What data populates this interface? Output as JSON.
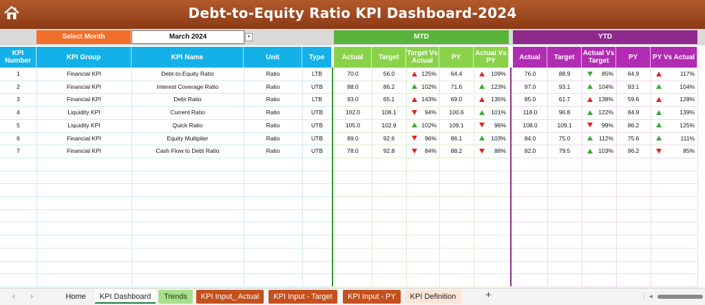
{
  "header": {
    "title": "Debt-to-Equity Ratio KPI Dashboard-2024"
  },
  "selector": {
    "label": "Select Month",
    "value": "March 2024"
  },
  "sections": {
    "mtd": "MTD",
    "ytd": "YTD"
  },
  "columns": {
    "kpi_number": "KPI Number",
    "kpi_group": "KPI Group",
    "kpi_name": "KPI Name",
    "unit": "Unit",
    "type": "Type",
    "mtd_actual": "Actual",
    "mtd_target": "Target",
    "mtd_tva": "Target Vs Actual",
    "mtd_py": "PY",
    "mtd_avp": "Actual Vs PY",
    "ytd_actual": "Actual",
    "ytd_target": "Target",
    "ytd_avt": "Actual Vs Target",
    "ytd_py": "PY",
    "ytd_pva": "PY Vs Actual"
  },
  "colors": {
    "up": "#3aa935",
    "down": "#e3231b",
    "banner": "#9a4420",
    "mtd": "#57b33a",
    "ytd": "#8e2a8c",
    "blue": "#14b1e8"
  },
  "rows": [
    {
      "num": "1",
      "group": "Financial KPI",
      "name": "Debt-to-Equity Ratio",
      "unit": "Ratio",
      "type": "LTB",
      "mtd_actual": "70.0",
      "mtd_target": "56.0",
      "mtd_tva": "125%",
      "mtd_tva_dir": "up-red",
      "mtd_py": "64.4",
      "mtd_avp": "109%",
      "mtd_avp_dir": "up-red",
      "ytd_actual": "76.0",
      "ytd_target": "88.9",
      "ytd_avt": "85%",
      "ytd_avt_dir": "down-green",
      "ytd_py": "64.9",
      "ytd_pva": "117%",
      "ytd_pva_dir": "up-red"
    },
    {
      "num": "2",
      "group": "Financial KPI",
      "name": "Interest Coverage Ratio",
      "unit": "Ratio",
      "type": "UTB",
      "mtd_actual": "88.0",
      "mtd_target": "86.2",
      "mtd_tva": "102%",
      "mtd_tva_dir": "up-green",
      "mtd_py": "71.6",
      "mtd_avp": "123%",
      "mtd_avp_dir": "up-green",
      "ytd_actual": "97.0",
      "ytd_target": "93.1",
      "ytd_avt": "104%",
      "ytd_avt_dir": "up-green",
      "ytd_py": "93.1",
      "ytd_pva": "104%",
      "ytd_pva_dir": "up-green"
    },
    {
      "num": "3",
      "group": "Financial KPI",
      "name": "Debt Ratio",
      "unit": "Ratio",
      "type": "LTB",
      "mtd_actual": "93.0",
      "mtd_target": "65.1",
      "mtd_tva": "143%",
      "mtd_tva_dir": "up-red",
      "mtd_py": "69.0",
      "mtd_avp": "135%",
      "mtd_avp_dir": "up-red",
      "ytd_actual": "85.0",
      "ytd_target": "61.7",
      "ytd_avt": "138%",
      "ytd_avt_dir": "up-red",
      "ytd_py": "59.6",
      "ytd_pva": "128%",
      "ytd_pva_dir": "up-red"
    },
    {
      "num": "4",
      "group": "Liquidity KPI",
      "name": "Current Ratio",
      "unit": "Ratio",
      "type": "UTB",
      "mtd_actual": "102.0",
      "mtd_target": "108.1",
      "mtd_tva": "94%",
      "mtd_tva_dir": "down-red",
      "mtd_py": "100.6",
      "mtd_avp": "101%",
      "mtd_avp_dir": "up-green",
      "ytd_actual": "118.0",
      "ytd_target": "96.8",
      "ytd_avt": "122%",
      "ytd_avt_dir": "up-green",
      "ytd_py": "84.9",
      "ytd_pva": "139%",
      "ytd_pva_dir": "up-green"
    },
    {
      "num": "5",
      "group": "Liquidity KPI",
      "name": "Quick Ratio",
      "unit": "Ratio",
      "type": "UTB",
      "mtd_actual": "105.0",
      "mtd_target": "102.9",
      "mtd_tva": "102%",
      "mtd_tva_dir": "up-green",
      "mtd_py": "109.1",
      "mtd_avp": "96%",
      "mtd_avp_dir": "down-red",
      "ytd_actual": "108.0",
      "ytd_target": "109.1",
      "ytd_avt": "99%",
      "ytd_avt_dir": "down-red",
      "ytd_py": "86.2",
      "ytd_pva": "125%",
      "ytd_pva_dir": "up-green"
    },
    {
      "num": "6",
      "group": "Financial KPI",
      "name": "Equity Multiplier",
      "unit": "Ratio",
      "type": "UTB",
      "mtd_actual": "89.0",
      "mtd_target": "92.6",
      "mtd_tva": "96%",
      "mtd_tva_dir": "down-red",
      "mtd_py": "86.1",
      "mtd_avp": "103%",
      "mtd_avp_dir": "up-green",
      "ytd_actual": "84.0",
      "ytd_target": "75.0",
      "ytd_avt": "112%",
      "ytd_avt_dir": "up-green",
      "ytd_py": "75.6",
      "ytd_pva": "111%",
      "ytd_pva_dir": "up-green"
    },
    {
      "num": "7",
      "group": "Financial KPI",
      "name": "Cash Flow to Debt Ratio",
      "unit": "Ratio",
      "type": "UTB",
      "mtd_actual": "78.0",
      "mtd_target": "92.8",
      "mtd_tva": "84%",
      "mtd_tva_dir": "down-red",
      "mtd_py": "88.2",
      "mtd_avp": "88%",
      "mtd_avp_dir": "down-red",
      "ytd_actual": "82.0",
      "ytd_target": "79.5",
      "ytd_avt": "103%",
      "ytd_avt_dir": "up-green",
      "ytd_py": "96.2",
      "ytd_pva": "85%",
      "ytd_pva_dir": "down-red"
    }
  ],
  "sheet_tabs": [
    {
      "label": "Home",
      "bg": "",
      "fg": "#222222"
    },
    {
      "label": "KPI Dashboard",
      "bg": "",
      "fg": "#222222",
      "active": true
    },
    {
      "label": "Trends",
      "bg": "#a8e08a",
      "fg": "#1d3a12"
    },
    {
      "label": "KPI Input_ Actual",
      "bg": "#c4501d",
      "fg": "#ffffff"
    },
    {
      "label": "KPI Input - Target",
      "bg": "#c4501d",
      "fg": "#ffffff"
    },
    {
      "label": "KPI Input - PY",
      "bg": "#c4501d",
      "fg": "#ffffff"
    },
    {
      "label": "KPI Definition",
      "bg": "#fde6d7",
      "fg": "#222222"
    }
  ]
}
